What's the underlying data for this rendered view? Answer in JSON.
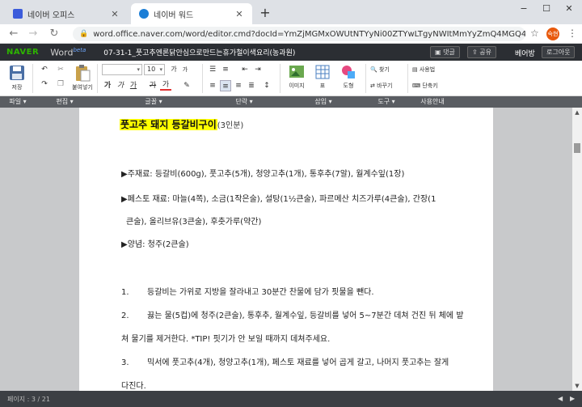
{
  "browser": {
    "tabs": [
      {
        "title": "네이버 오피스",
        "close": "✕",
        "color": "#3b5bdb"
      },
      {
        "title": "네이버 워드",
        "close": "✕",
        "color": "#1c7ed6"
      }
    ],
    "new_tab": "+",
    "window": {
      "minimize": "−",
      "maximize": "☐",
      "close": "✕"
    },
    "nav": {
      "back": "←",
      "forward": "→",
      "reload": "↻"
    },
    "url": "word.office.naver.com/word/editor.cmd?docId=YmZjMGMxOWUtNTYyNi00ZTYwLTgyNWItMmYyZmQ4MGQ4YjI2&baseFolder=%...",
    "lock": "🔒",
    "star": "☆",
    "avatar": "숙현",
    "menu": "⋮"
  },
  "appbar": {
    "logo": "NAVER",
    "product": "Word",
    "beta": "beta",
    "doc_title": "07-31-1_풋고추엔론닭안심으로만드는휴가철이색요리(농과원)",
    "comment_btn": "댓글",
    "share_btn": "공유",
    "user": "베어방",
    "logout_btn": "로그아웃"
  },
  "ribbon": {
    "save": "저장",
    "paste": "붙여넣기",
    "font_name": "",
    "font_size": "10",
    "bold": "가",
    "italic": "가",
    "underline": "가",
    "strike": "가",
    "fontcolor": "가",
    "image": "이미지",
    "table": "표",
    "shape": "도형",
    "find": "찾기",
    "replace": "바꾸기",
    "guide": "사용법",
    "shortcut": "단축키"
  },
  "ribbon_tabs": {
    "file": "파일",
    "edit": "편집",
    "font": "글꼴",
    "paragraph": "단락",
    "insert": "삽입",
    "tools": "도구",
    "help": "사용안내"
  },
  "document": {
    "title": "풋고추 돼지 등갈비구이",
    "serving": "(3인분)",
    "main_ing": "▶주재료: 등갈비(600g), 풋고추(5개), 청양고추(1개), 통후추(7알), 월계수잎(1장)",
    "pesto_1": "▶페스토 재료: 마늘(4쪽), 소금(1작은술), 설탕(1½큰술), 파르메산 치즈가루(4큰술), 간장(1",
    "pesto_2": "큰술), 올리브유(3큰술), 후춧가루(약간)",
    "sauce": "▶양념: 청주(2큰술)",
    "steps": [
      {
        "num": "1.",
        "text": "등갈비는 가위로 지방을 잘라내고 30분간 찬물에 담가 핏물을 뺀다."
      },
      {
        "num": "2.",
        "text": "끓는 물(5컵)에 청주(2큰술), 통후추, 월계수잎, 등갈비를 넣어 5~7분간 데쳐 건진 뒤 체에 밭"
      },
      {
        "num": "",
        "text": "쳐 물기를 제거한다. *TIP! 핏기가 안 보일 때까지 데쳐주세요."
      },
      {
        "num": "3.",
        "text": "믹서에 풋고추(4개), 청양고추(1개), 페스토 재료를 넣어 곱게 갈고, 나머지 풋고추는 잘게"
      },
      {
        "num": "",
        "text": "다진다."
      }
    ]
  },
  "status": {
    "page": "페이지 : 3 / 21",
    "prev": "◀",
    "next": "▶"
  }
}
